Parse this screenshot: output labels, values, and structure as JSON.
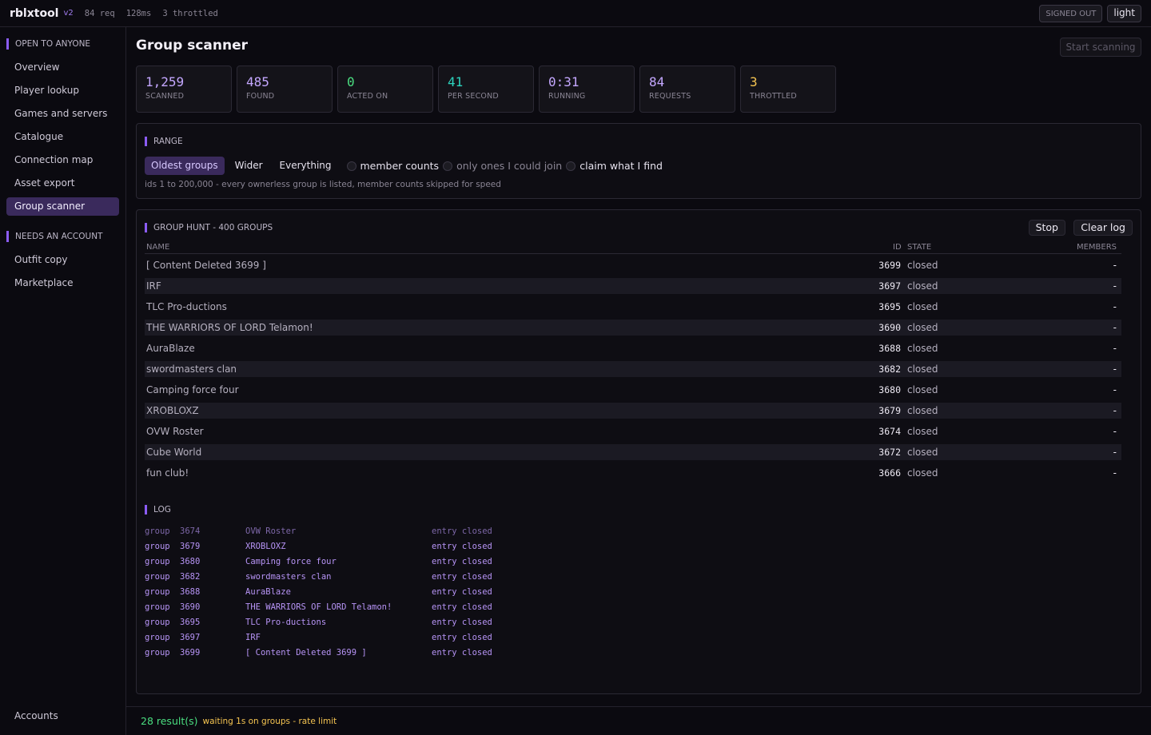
{
  "topbar": {
    "brand": "rblxtool",
    "version": "v2",
    "req": "84 req",
    "latency": "128ms",
    "throttled": "3 throttled",
    "signed_out": "SIGNED OUT",
    "theme_toggle": "light"
  },
  "sidebar": {
    "section_open": "OPEN TO ANYONE",
    "items_open": [
      "Overview",
      "Player lookup",
      "Games and servers",
      "Catalogue",
      "Connection map",
      "Asset export",
      "Group scanner"
    ],
    "section_account": "NEEDS AN ACCOUNT",
    "items_account": [
      "Outfit copy",
      "Marketplace"
    ],
    "accounts": "Accounts"
  },
  "page": {
    "title": "Group scanner",
    "start_button": "Start scanning"
  },
  "stats": [
    {
      "value": "1,259",
      "label": "SCANNED",
      "color": "#c4a7ff"
    },
    {
      "value": "485",
      "label": "FOUND",
      "color": "#c4a7ff"
    },
    {
      "value": "0",
      "label": "ACTED ON",
      "color": "#4ade80"
    },
    {
      "value": "41",
      "label": "PER SECOND",
      "color": "#2dd4bf"
    },
    {
      "value": "0:31",
      "label": "RUNNING",
      "color": "#c4a7ff"
    },
    {
      "value": "84",
      "label": "REQUESTS",
      "color": "#c4a7ff"
    },
    {
      "value": "3",
      "label": "THROTTLED",
      "color": "#f5c451"
    }
  ],
  "range": {
    "heading": "RANGE",
    "options": [
      "Oldest groups",
      "Wider",
      "Everything"
    ],
    "toggles": [
      "member counts",
      "only ones I could join",
      "claim what I find"
    ],
    "note": "ids 1 to 200,000 - every ownerless group is listed, member counts skipped for speed"
  },
  "hunt": {
    "heading": "GROUP HUNT - 400 GROUPS",
    "stop": "Stop",
    "clear_log": "Clear log",
    "columns": {
      "name": "NAME",
      "id": "ID",
      "state": "STATE",
      "members": "MEMBERS"
    },
    "rows": [
      {
        "name": "[ Content Deleted 3699 ]",
        "id": "3699",
        "state": "closed",
        "members": "-"
      },
      {
        "name": "IRF",
        "id": "3697",
        "state": "closed",
        "members": "-"
      },
      {
        "name": "TLC Pro-ductions",
        "id": "3695",
        "state": "closed",
        "members": "-"
      },
      {
        "name": "THE WARRIORS OF LORD Telamon!",
        "id": "3690",
        "state": "closed",
        "members": "-"
      },
      {
        "name": "AuraBlaze",
        "id": "3688",
        "state": "closed",
        "members": "-"
      },
      {
        "name": "swordmasters clan",
        "id": "3682",
        "state": "closed",
        "members": "-"
      },
      {
        "name": "Camping force four",
        "id": "3680",
        "state": "closed",
        "members": "-"
      },
      {
        "name": "XROBLOXZ",
        "id": "3679",
        "state": "closed",
        "members": "-"
      },
      {
        "name": "OVW Roster",
        "id": "3674",
        "state": "closed",
        "members": "-"
      },
      {
        "name": "Cube World",
        "id": "3672",
        "state": "closed",
        "members": "-"
      },
      {
        "name": "fun club!",
        "id": "3666",
        "state": "closed",
        "members": "-"
      }
    ]
  },
  "log": {
    "heading": "LOG",
    "entries": [
      {
        "kind": "group",
        "id": "3674",
        "name": "OVW Roster",
        "status": "entry closed"
      },
      {
        "kind": "group",
        "id": "3679",
        "name": "XROBLOXZ",
        "status": "entry closed"
      },
      {
        "kind": "group",
        "id": "3680",
        "name": "Camping force four",
        "status": "entry closed"
      },
      {
        "kind": "group",
        "id": "3682",
        "name": "swordmasters clan",
        "status": "entry closed"
      },
      {
        "kind": "group",
        "id": "3688",
        "name": "AuraBlaze",
        "status": "entry closed"
      },
      {
        "kind": "group",
        "id": "3690",
        "name": "THE WARRIORS OF LORD Telamon!",
        "status": "entry closed"
      },
      {
        "kind": "group",
        "id": "3695",
        "name": "TLC Pro-ductions",
        "status": "entry closed"
      },
      {
        "kind": "group",
        "id": "3697",
        "name": "IRF",
        "status": "entry closed"
      },
      {
        "kind": "group",
        "id": "3699",
        "name": "[ Content Deleted 3699 ]",
        "status": "entry closed"
      }
    ]
  },
  "footer": {
    "results": "28 result(s)",
    "status": "waiting 1s on groups - rate limit"
  }
}
